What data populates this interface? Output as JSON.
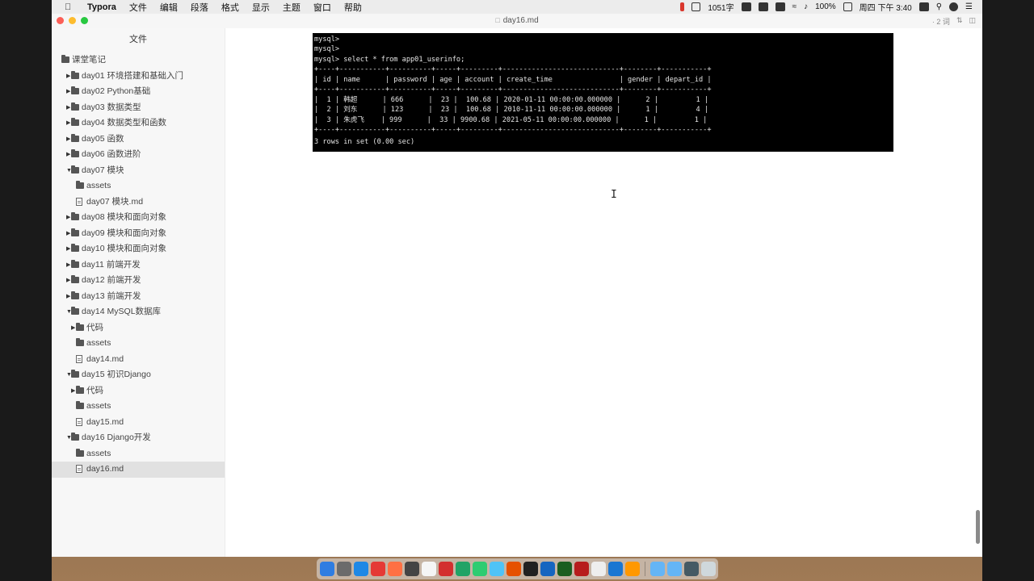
{
  "menubar": {
    "app_name": "Typora",
    "menus": [
      "文件",
      "编辑",
      "段落",
      "格式",
      "显示",
      "主题",
      "窗口",
      "帮助"
    ],
    "word_count": "1051字",
    "battery": "100%",
    "datetime": "周四 下午 3:40"
  },
  "window": {
    "title": "day16.md",
    "right_info": "· 2 词"
  },
  "sidebar": {
    "header": "文件",
    "items": [
      {
        "label": "课堂笔记",
        "type": "folder",
        "level": 0,
        "expanded": true
      },
      {
        "label": "day01 环境搭建和基础入门",
        "type": "folder",
        "level": 1,
        "expanded": false
      },
      {
        "label": "day02 Python基础",
        "type": "folder",
        "level": 1,
        "expanded": false
      },
      {
        "label": "day03 数据类型",
        "type": "folder",
        "level": 1,
        "expanded": false
      },
      {
        "label": "day04 数据类型和函数",
        "type": "folder",
        "level": 1,
        "expanded": false
      },
      {
        "label": "day05 函数",
        "type": "folder",
        "level": 1,
        "expanded": false
      },
      {
        "label": "day06 函数进阶",
        "type": "folder",
        "level": 1,
        "expanded": false
      },
      {
        "label": "day07 模块",
        "type": "folder",
        "level": 1,
        "expanded": true
      },
      {
        "label": "assets",
        "type": "folder-plain",
        "level": 2
      },
      {
        "label": "day07 模块.md",
        "type": "file",
        "level": 2
      },
      {
        "label": "day08 模块和面向对象",
        "type": "folder",
        "level": 1,
        "expanded": false
      },
      {
        "label": "day09 模块和面向对象",
        "type": "folder",
        "level": 1,
        "expanded": false
      },
      {
        "label": "day10 模块和面向对象",
        "type": "folder",
        "level": 1,
        "expanded": false
      },
      {
        "label": "day11 前端开发",
        "type": "folder",
        "level": 1,
        "expanded": false
      },
      {
        "label": "day12 前端开发",
        "type": "folder",
        "level": 1,
        "expanded": false
      },
      {
        "label": "day13 前端开发",
        "type": "folder",
        "level": 1,
        "expanded": false
      },
      {
        "label": "day14 MySQL数据库",
        "type": "folder",
        "level": 1,
        "expanded": true
      },
      {
        "label": "代码",
        "type": "folder",
        "level": 2,
        "expanded": false
      },
      {
        "label": "assets",
        "type": "folder-plain",
        "level": 2
      },
      {
        "label": "day14.md",
        "type": "file",
        "level": 2
      },
      {
        "label": "day15 初识Django",
        "type": "folder",
        "level": 1,
        "expanded": true
      },
      {
        "label": "代码",
        "type": "folder",
        "level": 2,
        "expanded": false
      },
      {
        "label": "assets",
        "type": "folder-plain",
        "level": 2
      },
      {
        "label": "day15.md",
        "type": "file",
        "level": 2
      },
      {
        "label": "day16 Django开发",
        "type": "folder",
        "level": 1,
        "expanded": true
      },
      {
        "label": "assets",
        "type": "folder-plain",
        "level": 2
      },
      {
        "label": "day16.md",
        "type": "file",
        "level": 2,
        "selected": true
      }
    ]
  },
  "terminal": {
    "lines": [
      "mysql>",
      "mysql>",
      "mysql> select * from app01_userinfo;",
      "+----+-----------+----------+-----+---------+----------------------------+--------+-----------+",
      "| id | name      | password | age | account | create_time                | gender | depart_id |",
      "+----+-----------+----------+-----+---------+----------------------------+--------+-----------+",
      "|  1 | 韩超      | 666      |  23 |  100.68 | 2020-01-11 00:00:00.000000 |      2 |         1 |",
      "|  2 | 刘东      | 123      |  23 |  100.68 | 2010-11-11 00:00:00.000000 |      1 |         4 |",
      "|  3 | 朱虎飞    | 999      |  33 | 9900.68 | 2021-05-11 00:00:00.000000 |      1 |         1 |",
      "+----+-----------+----------+-----+---------+----------------------------+--------+-----------+",
      "3 rows in set (0.00 sec)"
    ]
  },
  "colors": {
    "terminal_bg": "#000000",
    "sidebar_bg": "#f7f7f7",
    "selected_bg": "#e1e1e1"
  }
}
